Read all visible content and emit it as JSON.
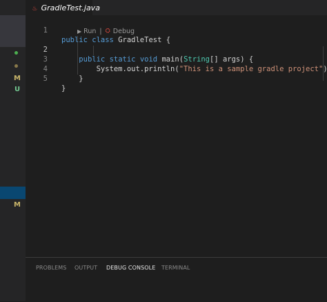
{
  "tab": {
    "filename": "GradleTest.java",
    "icon": "java-file-icon"
  },
  "sidebar": {
    "markers": [
      {
        "kind": "dot",
        "color": "#4caf50"
      },
      {
        "kind": "dot",
        "color": "#8a7a4a"
      },
      {
        "kind": "letter",
        "text": "M",
        "color": "#c8b56a"
      },
      {
        "kind": "letter",
        "text": "U",
        "color": "#73c991"
      },
      {
        "kind": "letter",
        "text": "M",
        "color": "#c8b56a"
      }
    ]
  },
  "editor": {
    "active_line": "2",
    "codelens": {
      "run": "Run",
      "separator": "|",
      "debug": "Debug"
    },
    "lines": [
      {
        "num": "1",
        "tokens": [
          [
            "kw",
            "public"
          ],
          [
            "t",
            " "
          ],
          [
            "kw",
            "class"
          ],
          [
            "t",
            " GradleTest {"
          ]
        ]
      },
      {
        "num": "2",
        "tokens": [
          [
            "t",
            "    "
          ],
          [
            "kw",
            "public"
          ],
          [
            "t",
            " "
          ],
          [
            "kw",
            "static"
          ],
          [
            "t",
            " "
          ],
          [
            "kw",
            "void"
          ],
          [
            "t",
            " main("
          ],
          [
            "ty",
            "String"
          ],
          [
            "t",
            "[] args) {"
          ]
        ]
      },
      {
        "num": "3",
        "tokens": [
          [
            "t",
            "        System.out.println("
          ],
          [
            "str",
            "\"This is a sample gradle project\""
          ],
          [
            "t",
            ");"
          ]
        ]
      },
      {
        "num": "4",
        "tokens": [
          [
            "t",
            "    }"
          ]
        ]
      },
      {
        "num": "5",
        "tokens": [
          [
            "t",
            "}"
          ]
        ]
      }
    ]
  },
  "panel": {
    "tabs": [
      {
        "label": "PROBLEMS",
        "active": false
      },
      {
        "label": "OUTPUT",
        "active": false
      },
      {
        "label": "DEBUG CONSOLE",
        "active": true
      },
      {
        "label": "TERMINAL",
        "active": false
      }
    ]
  },
  "colors": {
    "keyword": "#569cd6",
    "type": "#4ec9b0",
    "string": "#ce9178",
    "text": "#d4d4d4",
    "selection": "#094771"
  }
}
